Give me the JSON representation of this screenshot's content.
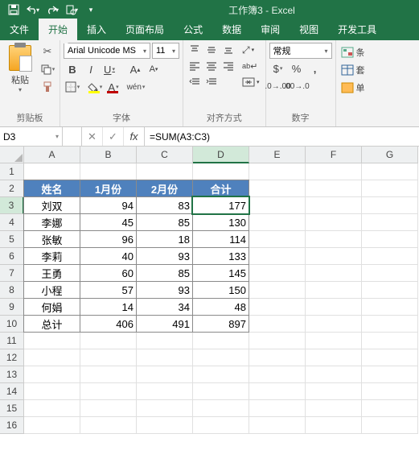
{
  "app": {
    "title": "工作簿3 - Excel"
  },
  "menu_tabs": [
    "文件",
    "开始",
    "插入",
    "页面布局",
    "公式",
    "数据",
    "审阅",
    "视图",
    "开发工具"
  ],
  "active_tab_index": 1,
  "ribbon": {
    "clipboard": {
      "paste": "粘贴",
      "group": "剪贴板"
    },
    "font": {
      "name": "Arial Unicode MS",
      "size": "11",
      "group": "字体"
    },
    "alignment": {
      "group": "对齐方式"
    },
    "number": {
      "format": "常规",
      "group": "数字"
    },
    "styles": {
      "cond": "条",
      "table": "套",
      "cell": "单"
    }
  },
  "namebox": "D3",
  "formula": "=SUM(A3:C3)",
  "columns": [
    "A",
    "B",
    "C",
    "D",
    "E",
    "F",
    "G"
  ],
  "rows": [
    "1",
    "2",
    "3",
    "4",
    "5",
    "6",
    "7",
    "8",
    "9",
    "10",
    "11",
    "12",
    "13",
    "14",
    "15",
    "16"
  ],
  "table": {
    "headers": [
      "姓名",
      "1月份",
      "2月份",
      "合计"
    ],
    "rows": [
      [
        "刘双",
        "94",
        "83",
        "177"
      ],
      [
        "李娜",
        "45",
        "85",
        "130"
      ],
      [
        "张敏",
        "96",
        "18",
        "114"
      ],
      [
        "李莉",
        "40",
        "93",
        "133"
      ],
      [
        "王勇",
        "60",
        "85",
        "145"
      ],
      [
        "小程",
        "57",
        "93",
        "150"
      ],
      [
        "何娟",
        "14",
        "34",
        "48"
      ],
      [
        "总计",
        "406",
        "491",
        "897"
      ]
    ]
  },
  "chart_data": {
    "type": "table",
    "title": "",
    "columns": [
      "姓名",
      "1月份",
      "2月份",
      "合计"
    ],
    "rows": [
      {
        "姓名": "刘双",
        "1月份": 94,
        "2月份": 83,
        "合计": 177
      },
      {
        "姓名": "李娜",
        "1月份": 45,
        "2月份": 85,
        "合计": 130
      },
      {
        "姓名": "张敏",
        "1月份": 96,
        "2月份": 18,
        "合计": 114
      },
      {
        "姓名": "李莉",
        "1月份": 40,
        "2月份": 93,
        "合计": 133
      },
      {
        "姓名": "王勇",
        "1月份": 60,
        "2月份": 85,
        "合计": 145
      },
      {
        "姓名": "小程",
        "1月份": 57,
        "2月份": 93,
        "合计": 150
      },
      {
        "姓名": "何娟",
        "1月份": 14,
        "2月份": 34,
        "合计": 48
      },
      {
        "姓名": "总计",
        "1月份": 406,
        "2月份": 491,
        "合计": 897
      }
    ]
  }
}
